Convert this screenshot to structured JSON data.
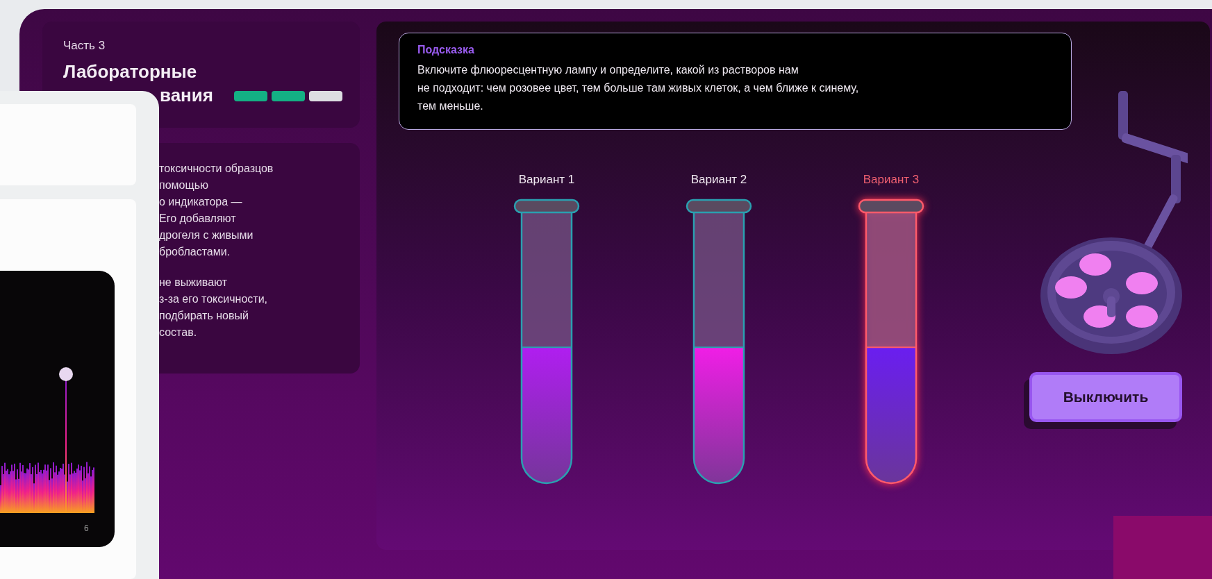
{
  "lesson_panel": {
    "part": "Часть 3",
    "title_line_1": "Лабораторные",
    "title_line_2": "вания",
    "progress": [
      {
        "done": true
      },
      {
        "done": true
      },
      {
        "done": false
      }
    ],
    "paragraph_1": [
      "токсичности образцов",
      "помощью",
      "о индикатора —",
      "Его добавляют",
      "дрогеля с живыми",
      "бробластами."
    ],
    "paragraph_2": [
      "не выживают",
      "з-за его токсичности,",
      "подбирать новый",
      "состав."
    ]
  },
  "hint": {
    "title": "Подсказка",
    "text": "Включите флюоресцентную лампу и определите, какой из растворов нам\nне подходит: чем розовее цвет, тем больше там живых клеток, а чем ближе к синему,\nтем меньше."
  },
  "tubes": [
    {
      "label": "Вариант 1",
      "selected": false,
      "level": 0.48,
      "color": "#b01ef0"
    },
    {
      "label": "Вариант 2",
      "selected": false,
      "level": 0.48,
      "color": "#f01ee6"
    },
    {
      "label": "Вариант 3",
      "selected": true,
      "level": 0.48,
      "color": "#6a1ef0"
    }
  ],
  "lamp_button": {
    "label": "Выключить"
  },
  "overlay_window": {
    "chart_tick": "6"
  }
}
